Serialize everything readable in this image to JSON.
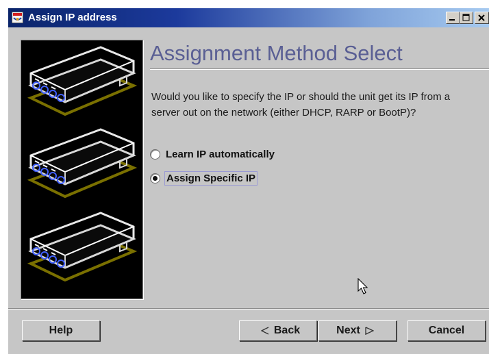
{
  "window": {
    "title": "Assign IP address",
    "controls": [
      "minimize-icon",
      "maximize-icon",
      "close-icon"
    ]
  },
  "page": {
    "heading": "Assignment Method Select",
    "question": "Would you like to specify the IP or should the unit get its IP from a server out on the network (either DHCP, RARP or BootP)?"
  },
  "options": [
    {
      "label": "Learn IP automatically",
      "selected": false
    },
    {
      "label": "Assign Specific IP",
      "selected": true
    }
  ],
  "buttons": {
    "help": "Help",
    "back": "Back",
    "next": "Next",
    "cancel": "Cancel"
  },
  "colors": {
    "heading": "#5a5f94",
    "titlebar_start": "#0a246a",
    "titlebar_end": "#a6caf0",
    "window_bg": "#c6c6c6"
  }
}
